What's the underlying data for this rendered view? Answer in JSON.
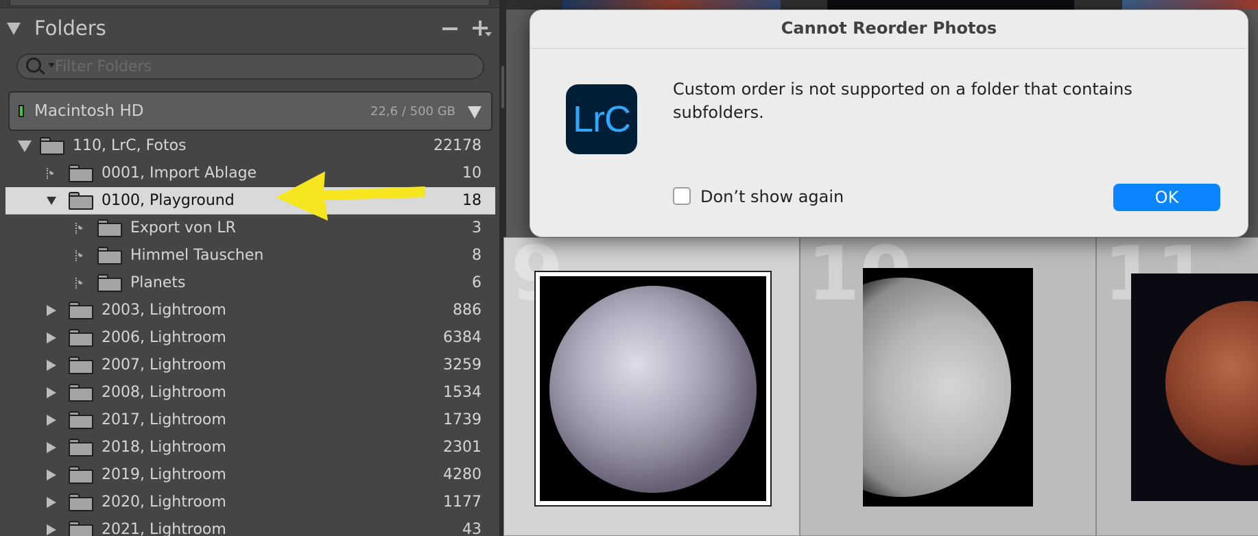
{
  "folders_panel": {
    "title": "Folders",
    "filter_placeholder": "Filter Folders",
    "volume": {
      "name": "Macintosh HD",
      "size": "22,6 / 500 GB",
      "status_color": "#46c04d"
    },
    "rows": [
      {
        "label": "110, LrC, Fotos",
        "count": "22178",
        "disclosure": "expanded"
      },
      {
        "label": "0001, Import Ablage",
        "count": "10",
        "disclosure": "collapsed-empty"
      },
      {
        "label": "0100, Playground",
        "count": "18",
        "disclosure": "expanded",
        "selected": true
      },
      {
        "label": "Export von LR",
        "count": "3",
        "disclosure": "collapsed-empty"
      },
      {
        "label": "Himmel Tauschen",
        "count": "8",
        "disclosure": "collapsed-empty"
      },
      {
        "label": "Planets",
        "count": "6",
        "disclosure": "collapsed-empty"
      },
      {
        "label": "2003, Lightroom",
        "count": "886",
        "disclosure": "collapsed"
      },
      {
        "label": "2006, Lightroom",
        "count": "6384",
        "disclosure": "collapsed"
      },
      {
        "label": "2007, Lightroom",
        "count": "3259",
        "disclosure": "collapsed"
      },
      {
        "label": "2008, Lightroom",
        "count": "1534",
        "disclosure": "collapsed"
      },
      {
        "label": "2017, Lightroom",
        "count": "1739",
        "disclosure": "collapsed"
      },
      {
        "label": "2018, Lightroom",
        "count": "2301",
        "disclosure": "collapsed"
      },
      {
        "label": "2019, Lightroom",
        "count": "4280",
        "disclosure": "collapsed"
      },
      {
        "label": "2020, Lightroom",
        "count": "1177",
        "disclosure": "collapsed"
      },
      {
        "label": "2021, Lightroom",
        "count": "43",
        "disclosure": "collapsed"
      }
    ]
  },
  "grid": {
    "cells": [
      {
        "index": "9",
        "selected": true
      },
      {
        "index": "10",
        "selected": false
      },
      {
        "index": "11",
        "selected": false
      }
    ]
  },
  "dialog": {
    "title": "Cannot Reorder Photos",
    "app_icon_text": "LrC",
    "message": "Custom order is not supported on a folder that contains subfolders.",
    "checkbox_label": "Don’t show again",
    "checkbox_checked": false,
    "ok_label": "OK",
    "accent_color": "#0a84ff"
  },
  "annotation": {
    "arrow_color": "#f5e620"
  }
}
